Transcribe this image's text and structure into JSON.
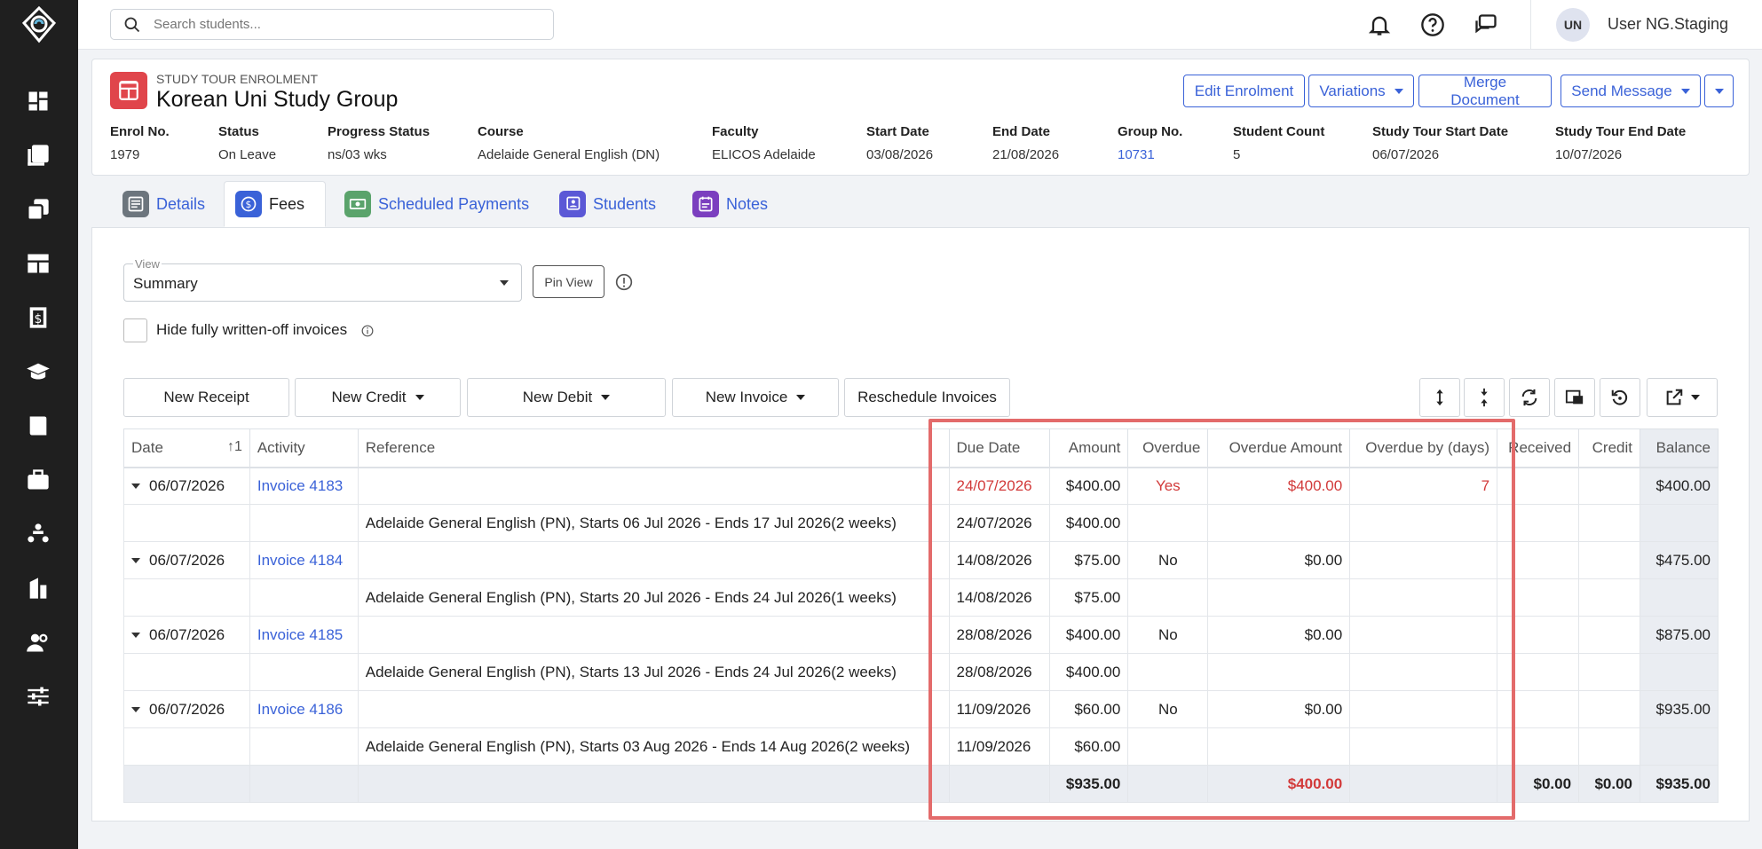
{
  "search": {
    "placeholder": "Search students..."
  },
  "user": {
    "initials": "UN",
    "name": "User NG.Staging"
  },
  "header": {
    "kicker": "STUDY TOUR ENROLMENT",
    "title": "Korean Uni Study Group",
    "buttons": {
      "edit": "Edit Enrolment",
      "variations": "Variations",
      "merge": "Merge Document",
      "send": "Send Message"
    },
    "meta": [
      {
        "label": "Enrol No.",
        "value": "1979"
      },
      {
        "label": "Status",
        "value": "On Leave"
      },
      {
        "label": "Progress Status",
        "value": "ns/03 wks"
      },
      {
        "label": "Course",
        "value": "Adelaide General English (DN)"
      },
      {
        "label": "Faculty",
        "value": "ELICOS Adelaide"
      },
      {
        "label": "Start Date",
        "value": "03/08/2026"
      },
      {
        "label": "End Date",
        "value": "21/08/2026"
      },
      {
        "label": "Group No.",
        "value": "10731"
      },
      {
        "label": "Student Count",
        "value": "5"
      },
      {
        "label": "Study Tour Start Date",
        "value": "06/07/2026"
      },
      {
        "label": "Study Tour End Date",
        "value": "10/07/2026"
      }
    ]
  },
  "tabs": [
    {
      "label": "Details",
      "color": "#6c757d"
    },
    {
      "label": "Fees",
      "color": "#3a62d8"
    },
    {
      "label": "Scheduled Payments",
      "color": "#5aa36b"
    },
    {
      "label": "Students",
      "color": "#5b58d6"
    },
    {
      "label": "Notes",
      "color": "#7b3fbf"
    }
  ],
  "view": {
    "label": "View",
    "value": "Summary",
    "pin": "Pin View"
  },
  "hide_written_off": "Hide fully written-off invoices",
  "toolbar": {
    "new_receipt": "New Receipt",
    "new_credit": "New Credit",
    "new_debit": "New Debit",
    "new_invoice": "New Invoice",
    "reschedule": "Reschedule Invoices"
  },
  "table": {
    "columns": {
      "date": "Date",
      "sort": "1",
      "activity": "Activity",
      "reference": "Reference",
      "due_date": "Due Date",
      "amount": "Amount",
      "overdue": "Overdue",
      "overdue_amount": "Overdue Amount",
      "overdue_days": "Overdue by (days)",
      "received": "Received",
      "credit": "Credit",
      "balance": "Balance"
    },
    "rows": [
      {
        "date": "06/07/2026",
        "activity": "Invoice 4183",
        "due": "24/07/2026",
        "amount": "$400.00",
        "overdue": "Yes",
        "overdue_amount": "$400.00",
        "days": "7",
        "balance": "$400.00",
        "detail": {
          "reference": "Adelaide General English (PN), Starts 06 Jul 2026 - Ends 17 Jul 2026(2 weeks)",
          "due": "24/07/2026",
          "amount": "$400.00"
        }
      },
      {
        "date": "06/07/2026",
        "activity": "Invoice 4184",
        "due": "14/08/2026",
        "amount": "$75.00",
        "overdue": "No",
        "overdue_amount": "$0.00",
        "days": "",
        "balance": "$475.00",
        "detail": {
          "reference": "Adelaide General English (PN), Starts 20 Jul 2026 - Ends 24 Jul 2026(1 weeks)",
          "due": "14/08/2026",
          "amount": "$75.00"
        }
      },
      {
        "date": "06/07/2026",
        "activity": "Invoice 4185",
        "due": "28/08/2026",
        "amount": "$400.00",
        "overdue": "No",
        "overdue_amount": "$0.00",
        "days": "",
        "balance": "$875.00",
        "detail": {
          "reference": "Adelaide General English (PN), Starts 13 Jul 2026 - Ends 24 Jul 2026(2 weeks)",
          "due": "28/08/2026",
          "amount": "$400.00"
        }
      },
      {
        "date": "06/07/2026",
        "activity": "Invoice 4186",
        "due": "11/09/2026",
        "amount": "$60.00",
        "overdue": "No",
        "overdue_amount": "$0.00",
        "days": "",
        "balance": "$935.00",
        "detail": {
          "reference": "Adelaide General English (PN), Starts 03 Aug 2026 - Ends 14 Aug 2026(2 weeks)",
          "due": "11/09/2026",
          "amount": "$60.00"
        }
      }
    ],
    "totals": {
      "amount": "$935.00",
      "overdue_amount": "$400.00",
      "received": "$0.00",
      "credit": "$0.00",
      "balance": "$935.00"
    }
  },
  "colors": {
    "accent": "#3a62d8",
    "danger": "#d23a3a",
    "highlight": "#e36b6b",
    "sidebar": "#1f1f1f"
  }
}
